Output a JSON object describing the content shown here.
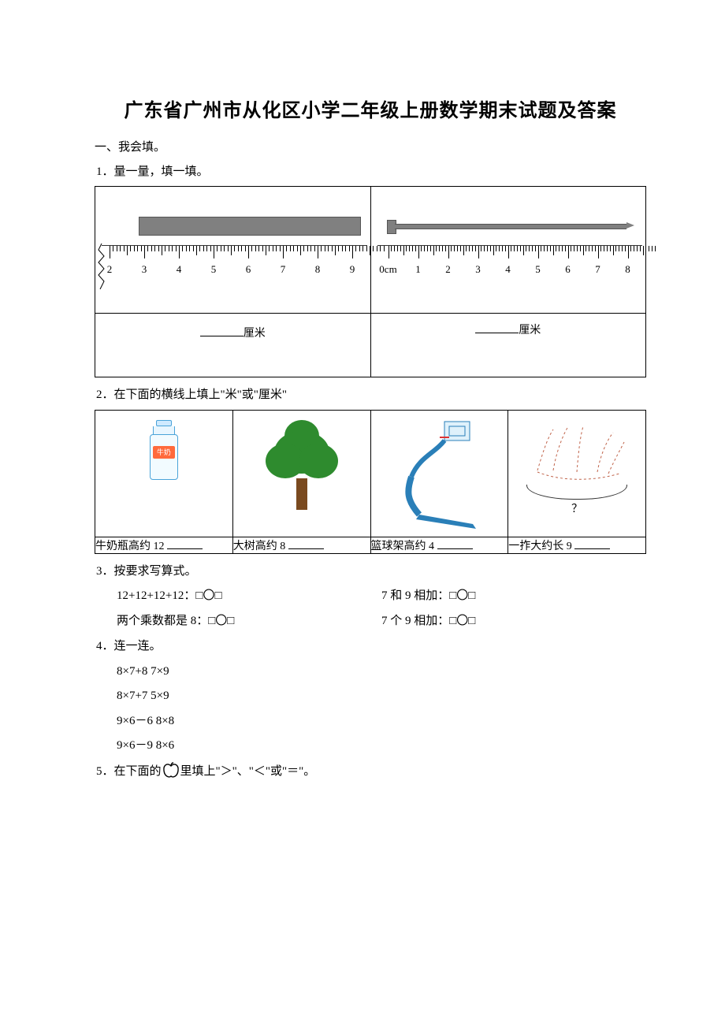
{
  "title": "广东省广州市从化区小学二年级上册数学期末试题及答案",
  "section1": "一、我会填。",
  "q1": {
    "text": "1．量一量，填一填。",
    "ruler1_nums": [
      "2",
      "3",
      "4",
      "5",
      "6",
      "7",
      "8",
      "9"
    ],
    "ruler2_nums": [
      "0cm",
      "1",
      "2",
      "3",
      "4",
      "5",
      "6",
      "7",
      "8"
    ],
    "unit": "厘米"
  },
  "q2": {
    "text": "2．在下面的横线上填上\"米\"或\"厘米\"",
    "milk_label": "牛奶",
    "items": [
      "牛奶瓶高约 12",
      "大树高约 8",
      "篮球架高约 4",
      "一拃大约长 9"
    ],
    "qmark": "？"
  },
  "q3": {
    "text": "3．按要求写算式。",
    "a": "12+12+12+12：□〇□",
    "b": "7 和 9 相加：□〇□",
    "c": "两个乘数都是 8：□〇□",
    "d": "7 个 9 相加：□〇□"
  },
  "q4": {
    "text": "4．连一连。",
    "lines": [
      "8×7+8  7×9",
      "8×7+7  5×9",
      "9×6－6 8×8",
      "9×6－9 8×6"
    ]
  },
  "q5": {
    "pre": "5．在下面的",
    "post": "里填上\"＞\"、\"＜\"或\"＝\"。"
  }
}
